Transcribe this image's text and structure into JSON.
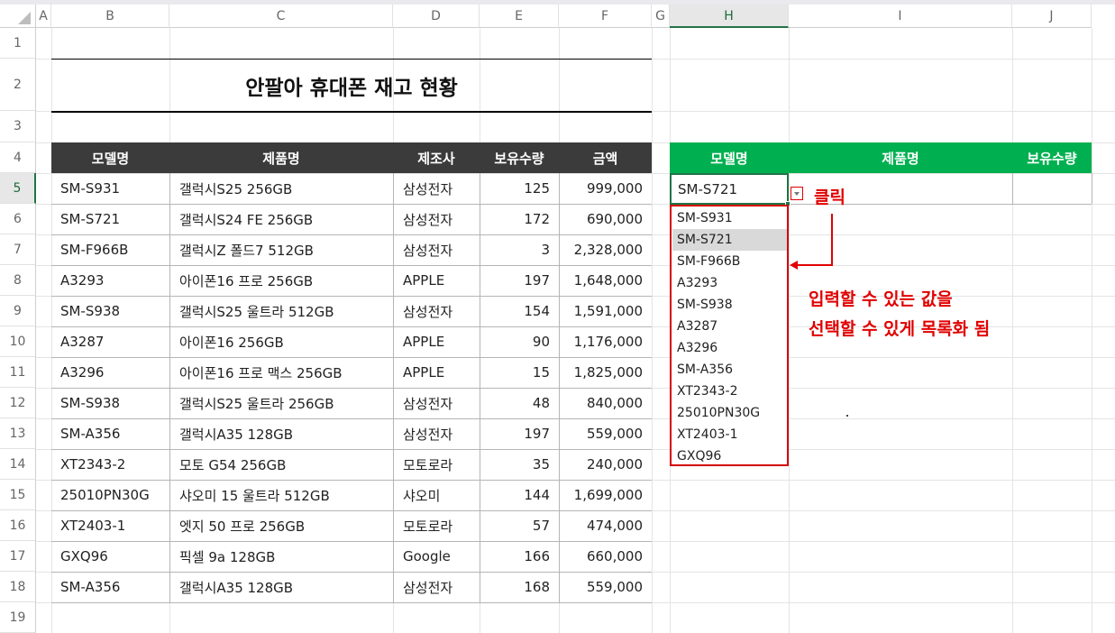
{
  "columns": [
    "A",
    "B",
    "C",
    "D",
    "E",
    "F",
    "G",
    "H",
    "I",
    "J"
  ],
  "rows": [
    "1",
    "2",
    "3",
    "4",
    "5",
    "6",
    "7",
    "8",
    "9",
    "10",
    "11",
    "12",
    "13",
    "14",
    "15",
    "16",
    "17",
    "18",
    "19"
  ],
  "sheet": {
    "title": "안팔아 휴대폰 재고 현황",
    "headers": [
      "모델명",
      "제품명",
      "제조사",
      "보유수량",
      "금액"
    ],
    "data": [
      [
        "SM-S931",
        "갤럭시S25 256GB",
        "삼성전자",
        "125",
        "999,000"
      ],
      [
        "SM-S721",
        "갤럭시S24 FE 256GB",
        "삼성전자",
        "172",
        "690,000"
      ],
      [
        "SM-F966B",
        "갤럭시Z 폴드7 512GB",
        "삼성전자",
        "3",
        "2,328,000"
      ],
      [
        "A3293",
        "아이폰16 프로 256GB",
        "APPLE",
        "197",
        "1,648,000"
      ],
      [
        "SM-S938",
        "갤럭시S25 울트라 512GB",
        "삼성전자",
        "154",
        "1,591,000"
      ],
      [
        "A3287",
        "아이폰16 256GB",
        "APPLE",
        "90",
        "1,176,000"
      ],
      [
        "A3296",
        "아이폰16 프로 맥스 256GB",
        "APPLE",
        "15",
        "1,825,000"
      ],
      [
        "SM-S938",
        "갤럭시S25 울트라 256GB",
        "삼성전자",
        "48",
        "840,000"
      ],
      [
        "SM-A356",
        "갤럭시A35 128GB",
        "삼성전자",
        "197",
        "559,000"
      ],
      [
        "XT2343-2",
        "모토 G54 256GB",
        "모토로라",
        "35",
        "240,000"
      ],
      [
        "25010PN30G",
        "샤오미 15 울트라 512GB",
        "샤오미",
        "144",
        "1,699,000"
      ],
      [
        "XT2403-1",
        "엣지 50 프로 256GB",
        "모토로라",
        "57",
        "474,000"
      ],
      [
        "GXQ96",
        "픽셀 9a 128GB",
        "Google",
        "166",
        "660,000"
      ],
      [
        "SM-A356",
        "갤럭시A35 128GB",
        "삼성전자",
        "168",
        "559,000"
      ]
    ]
  },
  "lookup": {
    "headers": [
      "모델명",
      "제품명",
      "보유수량"
    ],
    "selected_value": "SM-S721"
  },
  "dropdown": {
    "options": [
      "SM-S931",
      "SM-S721",
      "SM-F966B",
      "A3293",
      "SM-S938",
      "A3287",
      "A3296",
      "SM-A356",
      "XT2343-2",
      "25010PN30G",
      "XT2403-1",
      "GXQ96"
    ],
    "highlighted": "SM-S721"
  },
  "annotations": {
    "click_label": "클릭",
    "note_line1": "입력할 수 있는 값을",
    "note_line2": "선택할 수 있게 목록화 됨"
  },
  "colors": {
    "table_header": "#3b3b3b",
    "lookup_header": "#00b050",
    "annotation": "#e00000"
  }
}
